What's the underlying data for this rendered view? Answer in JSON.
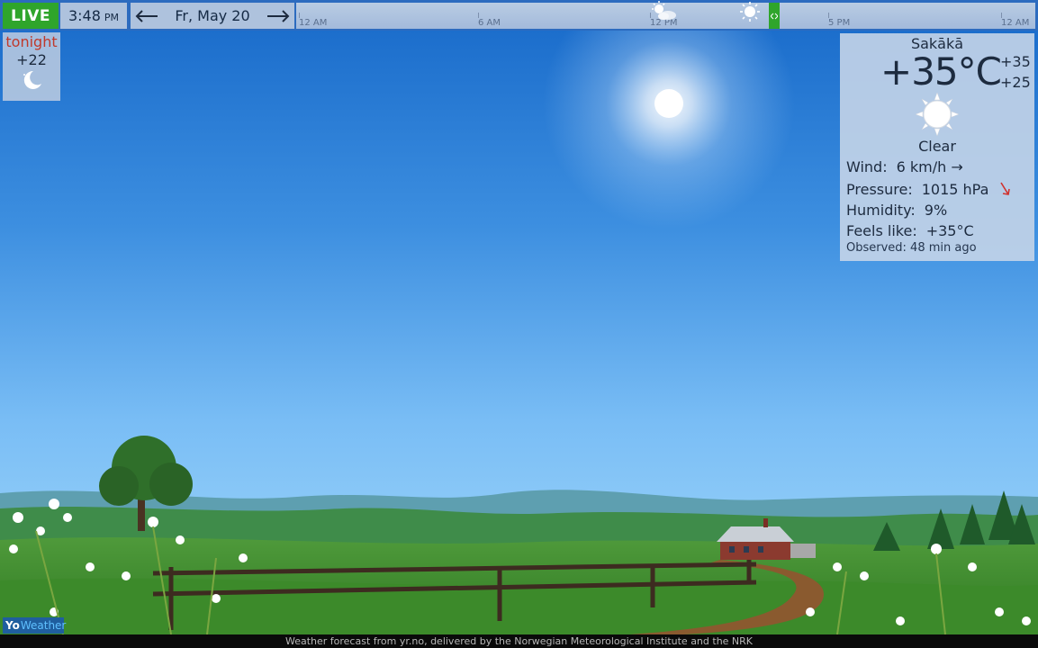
{
  "topbar": {
    "live_label": "LIVE",
    "time": "3:48",
    "ampm": "PM",
    "date": "Fr, May 20",
    "prev_icon": "arrow-left-icon",
    "next_icon": "arrow-right-icon",
    "timeline_ticks": [
      "12 AM",
      "6 AM",
      "12 PM",
      "5 PM",
      "12 AM"
    ],
    "timeline_icons": [
      "partly-cloudy-icon",
      "sun-icon"
    ]
  },
  "tonight": {
    "label": "tonight",
    "temp": "+22",
    "icon": "moon-icon"
  },
  "current": {
    "city": "Sakākā",
    "temp": "+35°C",
    "high": "+35",
    "low": "+25",
    "icon": "sun-icon",
    "condition": "Clear",
    "wind_label": "Wind:",
    "wind_value": "6 km/h →",
    "pressure_label": "Pressure:",
    "pressure_value": "1015 hPa",
    "pressure_trend_icon": "arrow-down-right-icon",
    "humidity_label": "Humidity:",
    "humidity_value": "9%",
    "feels_label": "Feels like:",
    "feels_value": "+35°C",
    "observed": "Observed:  48 min ago"
  },
  "footer": {
    "credit": "Weather forecast from yr.no, delivered by the Norwegian Meteorological Institute and the NRK",
    "logo_yo": "Yo",
    "logo_weather": "Weather"
  },
  "colors": {
    "live_green": "#2fa52b",
    "sky_top": "#1769c9",
    "sky_bottom": "#a8dcfb",
    "tonight_red": "#c0392b",
    "pressure_arrow": "#d0312d"
  }
}
